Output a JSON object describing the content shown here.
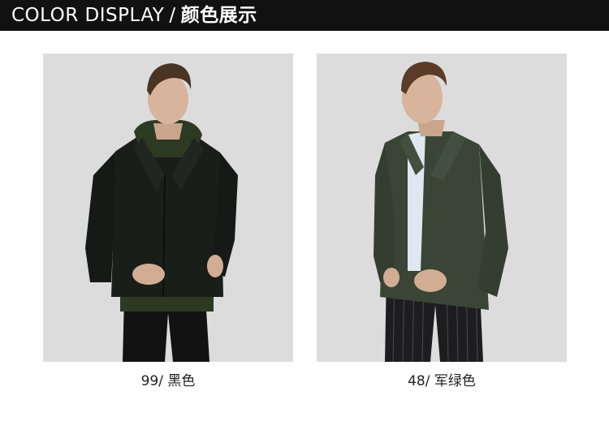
{
  "header": {
    "title_en": "COLOR DISPLAY",
    "separator": "/",
    "title_cn": "颜色展示"
  },
  "colors": {
    "header_bg": "#111111",
    "photo_bg": "#dcdcdc",
    "black_jacket": "#1a1e1a",
    "army_green_jacket": "#3a4536"
  },
  "products": [
    {
      "caption": "99/ 黑色",
      "jacket_color": "#1a1e1a"
    },
    {
      "caption": "48/ 军绿色",
      "jacket_color": "#3a4536"
    }
  ]
}
